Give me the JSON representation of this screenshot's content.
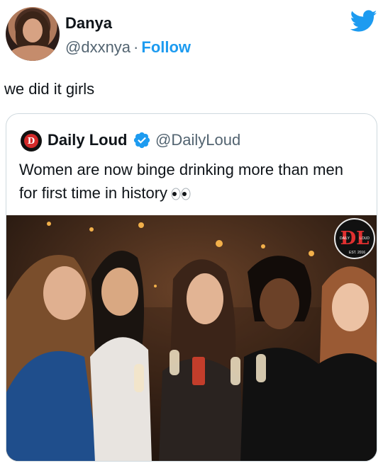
{
  "author": {
    "display_name": "Danya",
    "handle": "@dxxnya",
    "separator": "·",
    "follow_label": "Follow"
  },
  "tweet": {
    "text": "we did it girls"
  },
  "quoted_tweet": {
    "display_name": "Daily Loud",
    "handle": "@DailyLoud",
    "text": "Women are now binge drinking more than men for first time in history",
    "avatar_letter": "D",
    "verified": true
  },
  "media_watermark": {
    "mark": "DL",
    "left_text": "DAILY",
    "right_text": "LOUD",
    "est_text": "EST. 2016"
  },
  "colors": {
    "accent": "#1d9bf0",
    "text": "#0f1419",
    "muted": "#536471",
    "border": "#cfd9de",
    "brand_red": "#d42a2a"
  },
  "icons": {
    "platform": "twitter-bird-icon",
    "verified": "verified-badge-icon",
    "emoji": "eyes-icon"
  }
}
